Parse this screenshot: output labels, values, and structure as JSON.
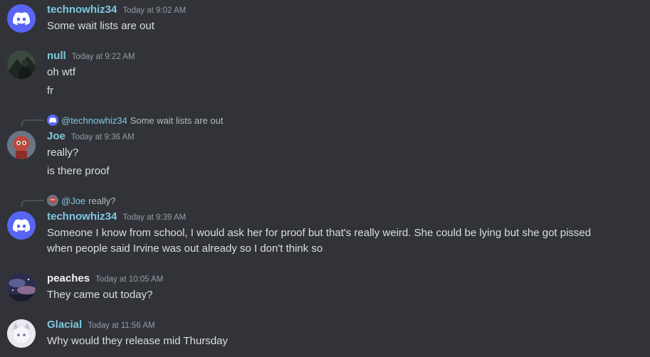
{
  "colors": {
    "background": "#313338",
    "username_teal": "#7ec9e0",
    "username_white": "#f2f3f5",
    "text": "#dbdee1",
    "muted": "#949ba4",
    "discord_blurple": "#5865f2"
  },
  "messages": [
    {
      "author": "technowhiz34",
      "timestamp": "Today at 9:02 AM",
      "avatar_icon": "discord-logo-icon",
      "lines": [
        "Some wait lists are out"
      ]
    },
    {
      "author": "null",
      "timestamp": "Today at 9:22 AM",
      "avatar_icon": "dark-portrait-avatar",
      "lines": [
        "oh wtf",
        "fr"
      ]
    },
    {
      "reply": {
        "mention": "@technowhiz34",
        "text": "Some wait lists are out",
        "avatar_icon": "discord-logo-icon"
      },
      "author": "Joe",
      "timestamp": "Today at 9:36 AM",
      "avatar_icon": "red-character-avatar",
      "lines": [
        "really?",
        "is there proof"
      ]
    },
    {
      "reply": {
        "mention": "@Joe",
        "text": "really?",
        "avatar_icon": "red-character-avatar"
      },
      "author": "technowhiz34",
      "timestamp": "Today at 9:39 AM",
      "avatar_icon": "discord-logo-icon",
      "lines": [
        "Someone I know from school, I would ask her for proof but that's really weird. She could be lying but she got pissed when people said Irvine was out already so I don't think so"
      ]
    },
    {
      "author": "peaches",
      "timestamp": "Today at 10:05 AM",
      "avatar_icon": "night-sky-avatar",
      "lines": [
        "They came out today?"
      ]
    },
    {
      "author": "Glacial",
      "timestamp": "Today at 11:56 AM",
      "avatar_icon": "white-character-avatar",
      "lines": [
        "Why would they release mid Thursday"
      ]
    }
  ]
}
